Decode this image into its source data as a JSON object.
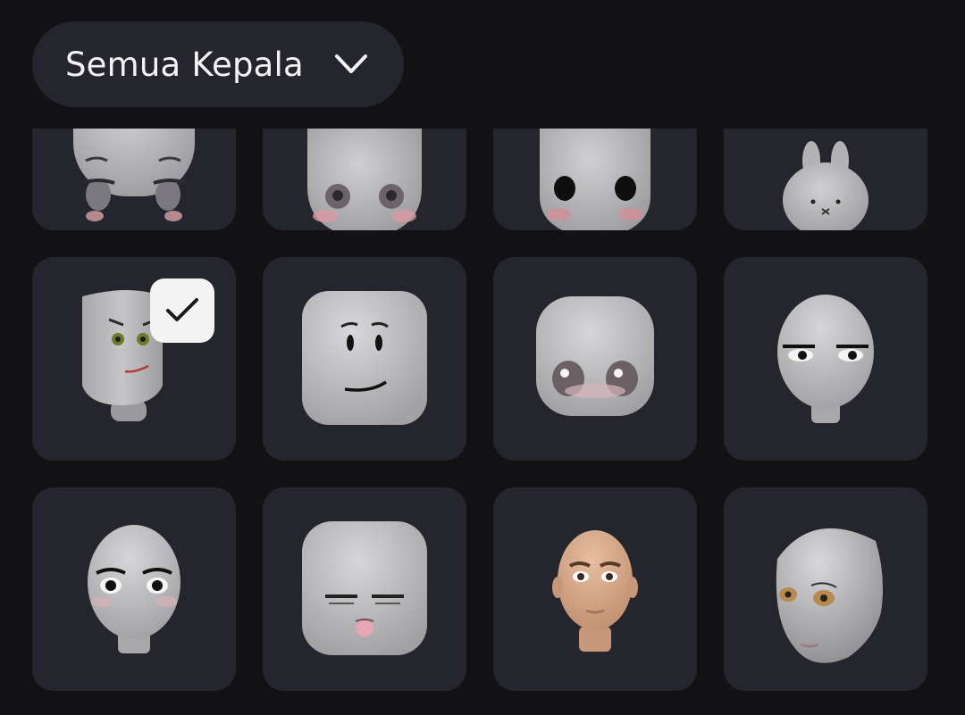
{
  "filter": {
    "label": "Semua Kepala",
    "icon": "chevron-down-icon"
  },
  "heads": [
    {
      "name": "head-item-gray-anime-brows",
      "selected": false
    },
    {
      "name": "head-item-gray-blush-eyes",
      "selected": false
    },
    {
      "name": "head-item-black-eye-dots",
      "selected": false
    },
    {
      "name": "head-item-bunny",
      "selected": false
    },
    {
      "name": "head-item-green-eyes-smirk",
      "selected": true
    },
    {
      "name": "head-item-classic-smile",
      "selected": false
    },
    {
      "name": "head-item-big-eyes-blush",
      "selected": false
    },
    {
      "name": "head-item-bored-eyes",
      "selected": false
    },
    {
      "name": "head-item-anime-lashes",
      "selected": false
    },
    {
      "name": "head-item-sleepy-tongue",
      "selected": false
    },
    {
      "name": "head-item-realistic-skin",
      "selected": false
    },
    {
      "name": "head-item-realistic-gray",
      "selected": false
    }
  ],
  "colors": {
    "background": "#121215",
    "tile": "#25262d",
    "head": "#bdbdbf",
    "check_badge": "#f4f4f4"
  }
}
